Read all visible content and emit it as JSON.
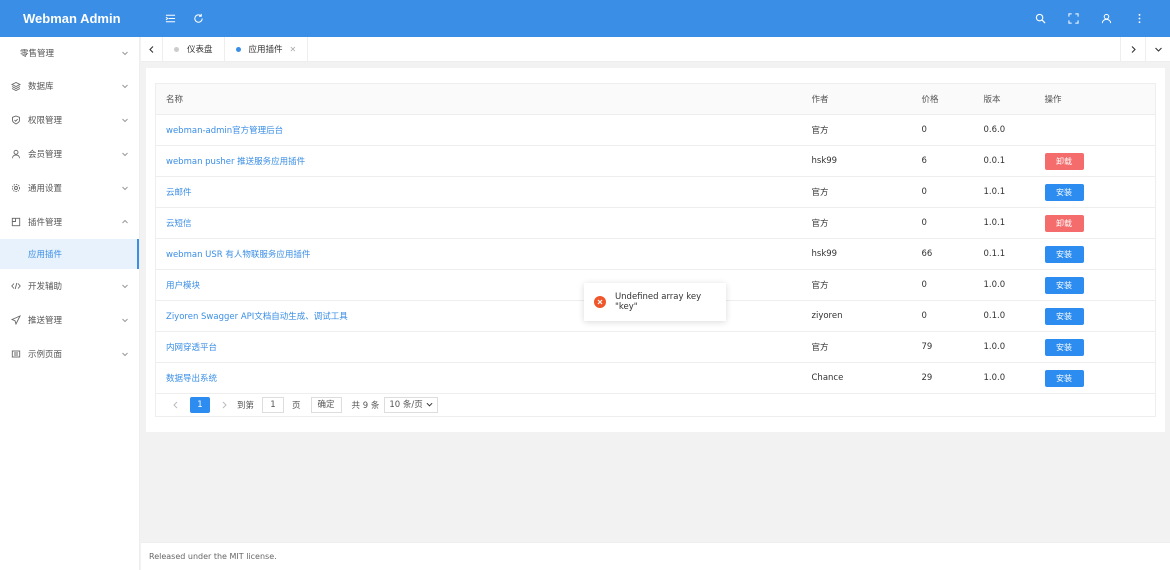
{
  "app": {
    "title": "Webman Admin"
  },
  "header": {
    "left_icons": [
      "menu-icon",
      "refresh-icon"
    ],
    "right_icons": [
      "search-icon",
      "fullscreen-icon",
      "user-icon",
      "more-icon"
    ]
  },
  "sidebar": {
    "items": [
      {
        "label": "零售管理",
        "icon": "",
        "expanded": false
      },
      {
        "label": "数据库",
        "icon": "database-icon",
        "expanded": false
      },
      {
        "label": "权限管理",
        "icon": "shield-icon",
        "expanded": false
      },
      {
        "label": "会员管理",
        "icon": "user-icon",
        "expanded": false
      },
      {
        "label": "通用设置",
        "icon": "gear-icon",
        "expanded": false
      },
      {
        "label": "插件管理",
        "icon": "plugin-icon",
        "expanded": true
      },
      {
        "label": "应用插件",
        "icon": "",
        "active": true
      },
      {
        "label": "开发辅助",
        "icon": "code-icon",
        "expanded": false
      },
      {
        "label": "推送管理",
        "icon": "send-icon",
        "expanded": false
      },
      {
        "label": "示例页面",
        "icon": "page-icon",
        "expanded": false
      }
    ]
  },
  "tabs": {
    "items": [
      {
        "label": "仪表盘",
        "active": false
      },
      {
        "label": "应用插件",
        "active": true,
        "close": "✕"
      }
    ]
  },
  "table": {
    "headers": [
      "名称",
      "作者",
      "价格",
      "版本",
      "操作"
    ],
    "rows": [
      {
        "name": "webman-admin官方管理后台",
        "author": "官方",
        "price": "0",
        "version": "0.6.0",
        "action": ""
      },
      {
        "name": "webman pusher 推送服务应用插件",
        "author": "hsk99",
        "price": "6",
        "version": "0.0.1",
        "action": "卸载"
      },
      {
        "name": "云邮件",
        "author": "官方",
        "price": "0",
        "version": "1.0.1",
        "action": "安装"
      },
      {
        "name": "云短信",
        "author": "官方",
        "price": "0",
        "version": "1.0.1",
        "action": "卸载"
      },
      {
        "name": "webman USR 有人物联服务应用插件",
        "author": "hsk99",
        "price": "66",
        "version": "0.1.1",
        "action": "安装"
      },
      {
        "name": "用户模块",
        "author": "官方",
        "price": "0",
        "version": "1.0.0",
        "action": "安装"
      },
      {
        "name": "Ziyoren Swagger API文档自动生成、调试工具",
        "author": "ziyoren",
        "price": "0",
        "version": "0.1.0",
        "action": "安装"
      },
      {
        "name": "内网穿透平台",
        "author": "官方",
        "price": "79",
        "version": "1.0.0",
        "action": "安装"
      },
      {
        "name": "数据导出系统",
        "author": "Chance",
        "price": "29",
        "version": "1.0.0",
        "action": "安装"
      }
    ]
  },
  "pager": {
    "current": "1",
    "goto_label": "到第",
    "goto_value": "1",
    "page_unit": "页",
    "confirm": "确定",
    "total": "共 9 条",
    "page_size": "10 条/页"
  },
  "toast": {
    "message": "Undefined array key \"key\"",
    "type": "error"
  },
  "footer": {
    "text": "Released under the MIT license."
  },
  "colors": {
    "primary": "#3a8ee6",
    "install": "#2d8cf0",
    "uninstall": "#f56c6c",
    "error": "#f0562b"
  }
}
